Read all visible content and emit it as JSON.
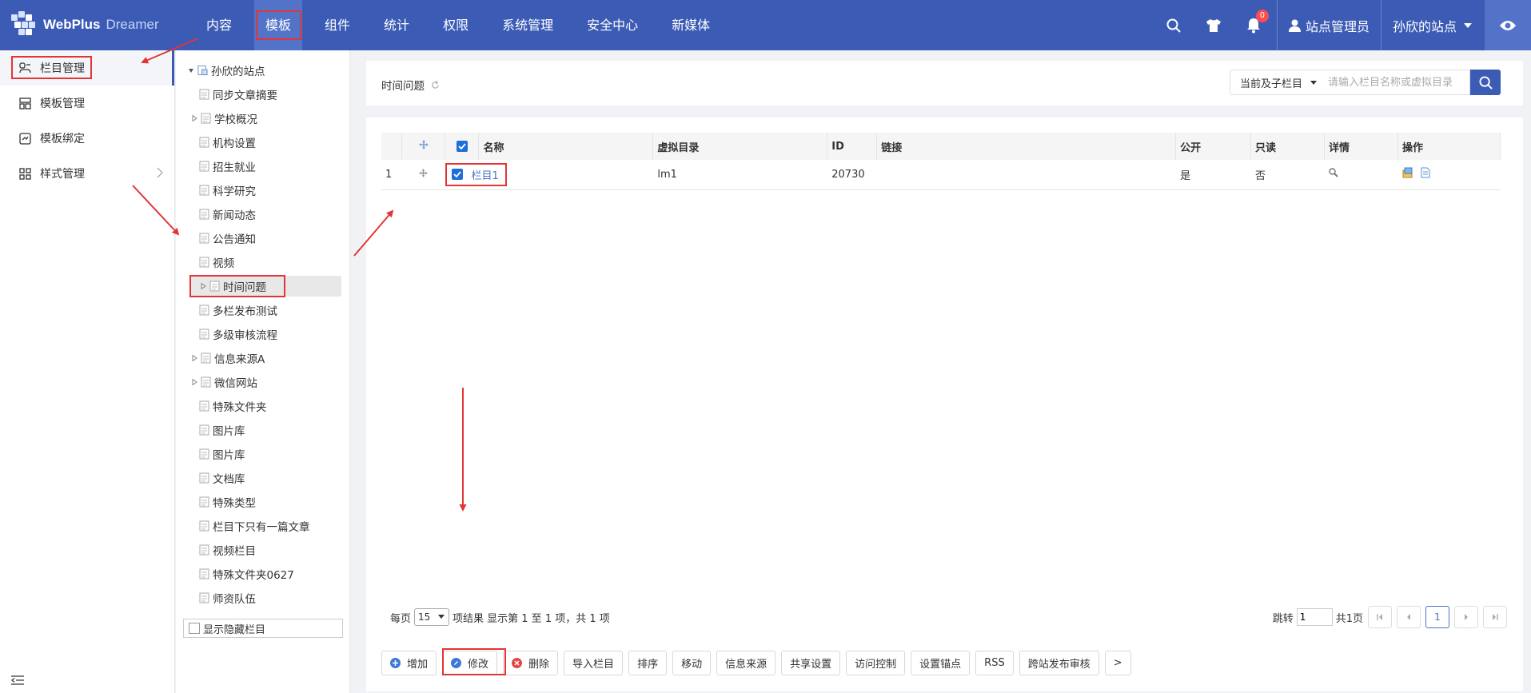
{
  "brand": {
    "name": "WebPlus",
    "sub": "Dreamer"
  },
  "nav": [
    "内容",
    "模板",
    "组件",
    "统计",
    "权限",
    "系统管理",
    "安全中心",
    "新媒体"
  ],
  "topbar": {
    "notify_count": "0",
    "user": "站点管理员",
    "site": "孙欣的站点"
  },
  "sidebar": [
    {
      "label": "栏目管理",
      "icon": "column-icon"
    },
    {
      "label": "模板管理",
      "icon": "template-icon"
    },
    {
      "label": "模板绑定",
      "icon": "bind-icon"
    },
    {
      "label": "样式管理",
      "icon": "style-icon"
    }
  ],
  "tree": {
    "root": "孙欣的站点",
    "items": [
      "同步文章摘要",
      "学校概况",
      "机构设置",
      "招生就业",
      "科学研究",
      "新闻动态",
      "公告通知",
      "视频",
      "时间问题",
      "多栏发布测试",
      "多级审核流程",
      "信息来源A",
      "微信网站",
      "特殊文件夹",
      "图片库",
      "图片库",
      "文档库",
      "特殊类型",
      "栏目下只有一篇文章",
      "视频栏目",
      "特殊文件夹0627",
      "师资队伍"
    ],
    "show_hidden": "显示隐藏栏目"
  },
  "page": {
    "title": "时间问题"
  },
  "search": {
    "scope": "当前及子栏目",
    "placeholder": "请输入栏目名称或虚拟目录"
  },
  "table": {
    "headers": {
      "name": "名称",
      "vdir": "虚拟目录",
      "id": "ID",
      "link": "链接",
      "public": "公开",
      "readonly": "只读",
      "detail": "详情",
      "ops": "操作"
    },
    "rows": [
      {
        "index": "1",
        "name": "栏目1",
        "vdir": "lm1",
        "id": "20730",
        "link": "",
        "public": "是",
        "readonly": "否"
      }
    ]
  },
  "pager": {
    "per_page_label": "每页",
    "per_page": "15",
    "summary": "项结果 显示第 1 至 1 项，共 1 项",
    "jump_label": "跳转",
    "jump_value": "1",
    "total_pages": "共1页",
    "current": "1"
  },
  "buttons": [
    "增加",
    "修改",
    "删除",
    "导入栏目",
    "排序",
    "移动",
    "信息来源",
    "共享设置",
    "访问控制",
    "设置锚点",
    "RSS",
    "跨站发布审核",
    ">"
  ],
  "colors": {
    "primary": "#3b5bb5",
    "annotation": "#e23636"
  }
}
